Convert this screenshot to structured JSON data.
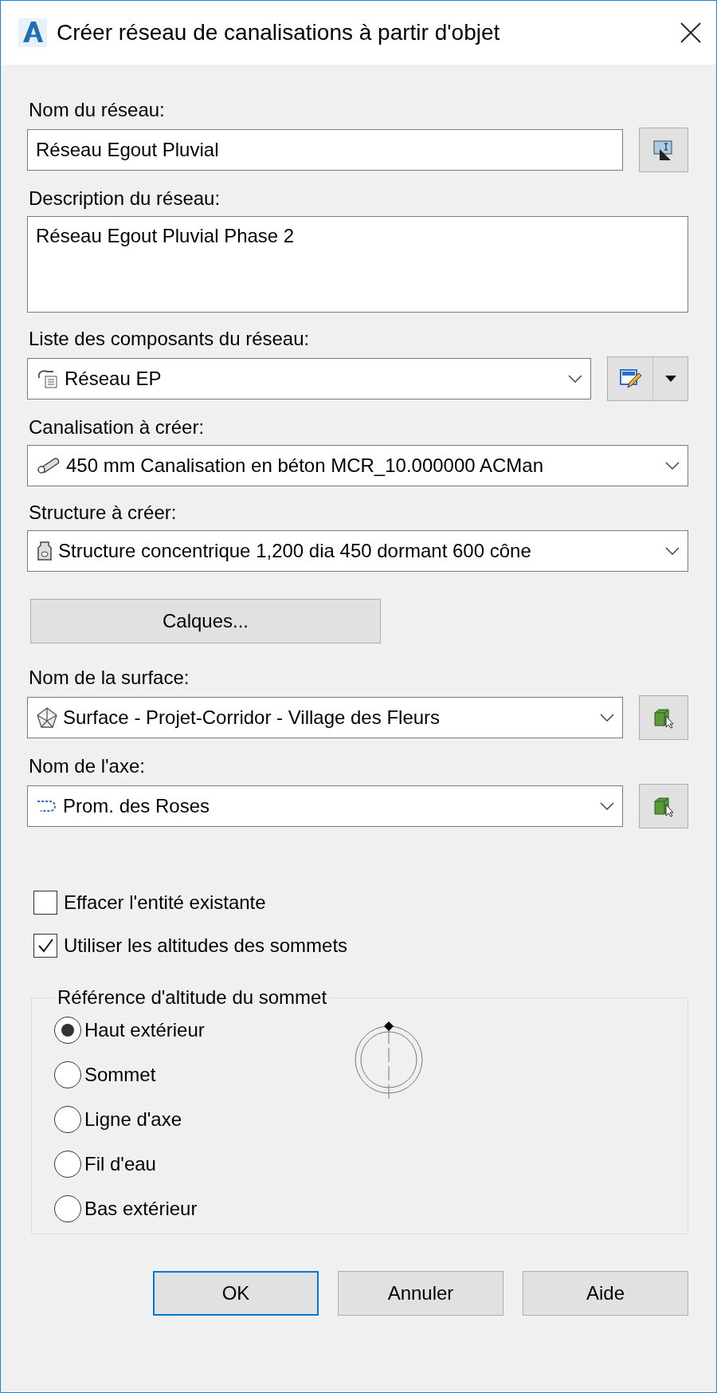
{
  "window": {
    "title": "Créer réseau de canalisations à partir d'objet"
  },
  "network_name": {
    "label": "Nom du réseau:",
    "value": "Réseau Egout Pluvial"
  },
  "network_description": {
    "label": "Description du réseau:",
    "value": "Réseau Egout Pluvial Phase 2"
  },
  "parts_list": {
    "label": "Liste des composants du réseau:",
    "value": "Réseau EP"
  },
  "pipe": {
    "label": "Canalisation à créer:",
    "value": "450 mm Canalisation en béton MCR_10.000000 ACMan"
  },
  "structure": {
    "label": "Structure à créer:",
    "value": "Structure concentrique 1,200 dia 450 dormant 600 cône"
  },
  "layers_button": "Calques...",
  "surface": {
    "label": "Nom de la surface:",
    "value": "Surface - Projet-Corridor - Village des Fleurs"
  },
  "alignment": {
    "label": "Nom de l'axe:",
    "value": "Prom. des Roses"
  },
  "checkboxes": [
    {
      "label": "Effacer l'entité existante",
      "checked": false
    },
    {
      "label": "Utiliser les altitudes des sommets",
      "checked": true
    }
  ],
  "vertex_reference": {
    "title": "Référence d'altitude du sommet",
    "options": [
      {
        "label": "Haut extérieur",
        "selected": true
      },
      {
        "label": "Sommet",
        "selected": false
      },
      {
        "label": "Ligne d'axe",
        "selected": false
      },
      {
        "label": "Fil d'eau",
        "selected": false
      },
      {
        "label": "Bas extérieur",
        "selected": false
      }
    ]
  },
  "buttons": [
    {
      "label": "OK",
      "default": true
    },
    {
      "label": "Annuler",
      "default": false
    },
    {
      "label": "Aide",
      "default": false
    }
  ]
}
